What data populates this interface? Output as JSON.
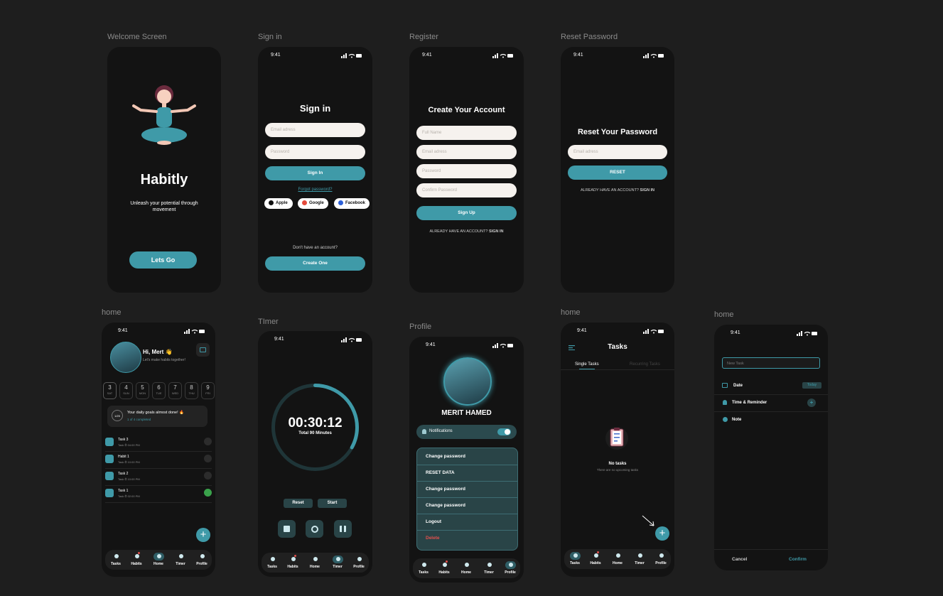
{
  "frames": {
    "welcome": "Welcome Screen",
    "signin": "Sign in",
    "register": "Register",
    "reset": "Reset Password",
    "home1": "home",
    "timer": "TImer",
    "profile": "Profile",
    "home2": "home",
    "home3": "home"
  },
  "status_time": "9:41",
  "welcome": {
    "app_name": "Habitly",
    "tagline": "Unleash your potential  through movement",
    "cta": "Lets Go"
  },
  "signin": {
    "title": "Sign in",
    "email_placeholder": "Email adress",
    "password_placeholder": "Password",
    "signin_button": "Sign In",
    "forgot": "Forgot password?",
    "apple": "Apple",
    "google": "Google",
    "facebook": "Facebook",
    "no_account": "Don't have an account?",
    "create": "Create One"
  },
  "register": {
    "title": "Create Your Account",
    "fullname_placeholder": "Full Name",
    "email_placeholder": "Email adress",
    "password_placeholder": "Password",
    "confirm_placeholder": "Confirm Password",
    "signup_button": "Sign Up",
    "have_account": "ALREADY HAVE AN ACCOUNT?",
    "signin_link": "SIGN IN"
  },
  "reset": {
    "title": "Reset Your Password",
    "email_placeholder": "Email adress",
    "reset_button": "RESET",
    "have_account": "ALREADY HAVE AN ACCOUNT?",
    "signin_link": "SIGN IN"
  },
  "home": {
    "greeting": "Hi, Mert 👋",
    "subtitle": "Let's make habits together!",
    "days": [
      {
        "num": "3",
        "name": "SAT"
      },
      {
        "num": "4",
        "name": "SUN"
      },
      {
        "num": "5",
        "name": "MON"
      },
      {
        "num": "6",
        "name": "TUE"
      },
      {
        "num": "7",
        "name": "WED"
      },
      {
        "num": "8",
        "name": "THU"
      },
      {
        "num": "9",
        "name": "FRI"
      }
    ],
    "goal_badge": "1/25",
    "goal_title": "Your daily goals almost done! 🔥",
    "goal_sub": "1 of 4 completed",
    "tasks": [
      {
        "name": "Task 3",
        "time": "04:00 PM"
      },
      {
        "name": "Habit 1",
        "time": "10:00 PM"
      },
      {
        "name": "Task 2",
        "time": "10:00 PM"
      },
      {
        "name": "Task 1",
        "time": "02:00 PM"
      }
    ],
    "tag": "Task",
    "fab": "+"
  },
  "nav": {
    "tasks": "Tasks",
    "habits": "Habits",
    "home": "Home",
    "timer": "Timer",
    "profile": "Profile"
  },
  "timer": {
    "time": "00:30:12",
    "total": "Total 90 Minutes",
    "reset": "Reset",
    "start": "Start",
    "progress": 0.33
  },
  "profile": {
    "name": "MERIT  HAMED",
    "notifications": "Notifications",
    "menu": [
      "Change password",
      "RESET DATA",
      "Change password",
      "Change password",
      "Logout",
      "Delete"
    ]
  },
  "tasks_screen": {
    "title": "Tasks",
    "tab_single": "Single Tasks",
    "tab_recurring": "Recurring Tasks",
    "empty_title": "No tasks",
    "empty_sub": "There are no upcoming tasks",
    "fab": "+"
  },
  "new_task": {
    "placeholder": "New Task",
    "date": "Date",
    "today": "Today",
    "time_reminder": "Time & Reminder",
    "note": "Note",
    "cancel": "Cancel",
    "confirm": "Confirm"
  },
  "colors": {
    "accent": "#3f9aa8",
    "background": "#1e1e1e",
    "phone": "#131313",
    "input": "#f6f2ee",
    "danger": "#e2504d"
  }
}
